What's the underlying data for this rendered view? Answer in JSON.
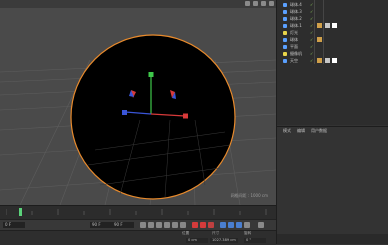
{
  "viewport": {
    "readout": "网格间距 : 1000 cm"
  },
  "objects": [
    {
      "name": "球体.4",
      "color": "#5aa0ff"
    },
    {
      "name": "球体.3",
      "color": "#5aa0ff"
    },
    {
      "name": "球体.2",
      "color": "#5aa0ff"
    },
    {
      "name": "球体.1",
      "color": "#5aa0ff"
    },
    {
      "name": "灯光",
      "color": "#e8d44a"
    },
    {
      "name": "球体",
      "color": "#5aa0ff"
    },
    {
      "name": "平面",
      "color": "#5aa0ff"
    },
    {
      "name": "摄像机",
      "color": "#e8d44a"
    },
    {
      "name": "天空",
      "color": "#5aa0ff"
    }
  ],
  "attributes": {
    "tabs": [
      "模式",
      "编辑",
      "用户数据"
    ]
  },
  "timeline": {
    "start": "0 F",
    "current": "90 F",
    "end": "90 F"
  },
  "coords": {
    "pos_label": "位置",
    "size_label": "尺寸",
    "rot_label": "旋转",
    "x_value": "0 cm",
    "size_value": "1027.389 cm",
    "h_value": "0 °"
  }
}
